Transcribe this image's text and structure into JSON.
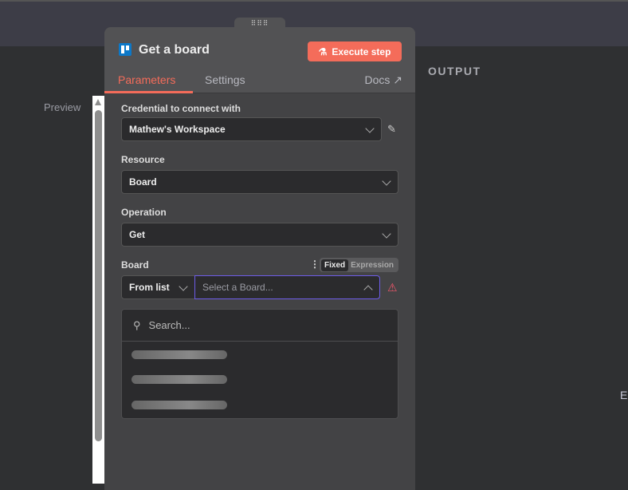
{
  "canvas": {
    "preview_label": "Preview",
    "output_label": "OUTPUT",
    "edge_text": "E"
  },
  "panel": {
    "title": "Get a board",
    "execute_label": "Execute step",
    "tabs": [
      {
        "label": "Parameters",
        "active": true
      },
      {
        "label": "Settings",
        "active": false
      }
    ],
    "docs_label": "Docs",
    "fields": {
      "credential": {
        "label": "Credential to connect with",
        "value": "Mathew's Workspace"
      },
      "resource": {
        "label": "Resource",
        "value": "Board"
      },
      "operation": {
        "label": "Operation",
        "value": "Get"
      },
      "board": {
        "label": "Board",
        "mode": "From list",
        "placeholder": "Select a Board...",
        "toggle_fixed": "Fixed",
        "toggle_expression": "Expression"
      }
    },
    "dropdown": {
      "search_placeholder": "Search..."
    }
  },
  "colors": {
    "accent": "#f46c5a",
    "focus": "#6d5ce8",
    "warning": "#f0566a",
    "trello": "#0c78c8"
  }
}
